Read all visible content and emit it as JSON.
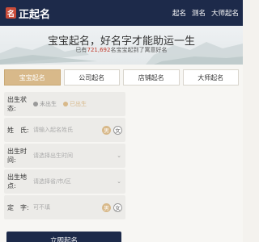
{
  "brand": {
    "mark": "名",
    "name": "正起名"
  },
  "nav": [
    "起名",
    "测名",
    "大师起名"
  ],
  "hero": {
    "title": "宝宝起名，好名字才能助运一生",
    "sub_prefix": "已有",
    "count": "721,692",
    "sub_suffix": "名宝宝起到了寓意好名"
  },
  "tabs": [
    "宝宝起名",
    "公司起名",
    "店铺起名",
    "大师起名"
  ],
  "form": {
    "status": {
      "label": "出生状态:",
      "opt1": "未出生",
      "opt2": "已出生"
    },
    "surname": {
      "label": "姓　氏:",
      "placeholder": "请输入起名姓氏",
      "male": "男",
      "female": "女"
    },
    "time": {
      "label": "出生时间:",
      "placeholder": "请选择出生时间"
    },
    "place": {
      "label": "出生地点:",
      "placeholder": "请选择省/市/区"
    },
    "fixed": {
      "label": "定　字:",
      "placeholder": "可不填",
      "male": "男",
      "female": "女"
    },
    "submit": "立即起名"
  }
}
